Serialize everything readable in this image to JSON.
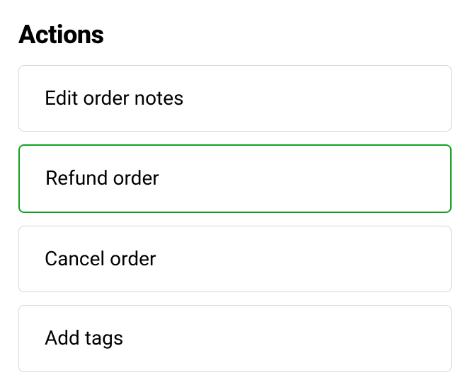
{
  "title": "Actions",
  "actions": [
    {
      "label": "Edit order notes",
      "highlighted": false
    },
    {
      "label": "Refund order",
      "highlighted": true
    },
    {
      "label": "Cancel order",
      "highlighted": false
    },
    {
      "label": "Add tags",
      "highlighted": false
    }
  ]
}
